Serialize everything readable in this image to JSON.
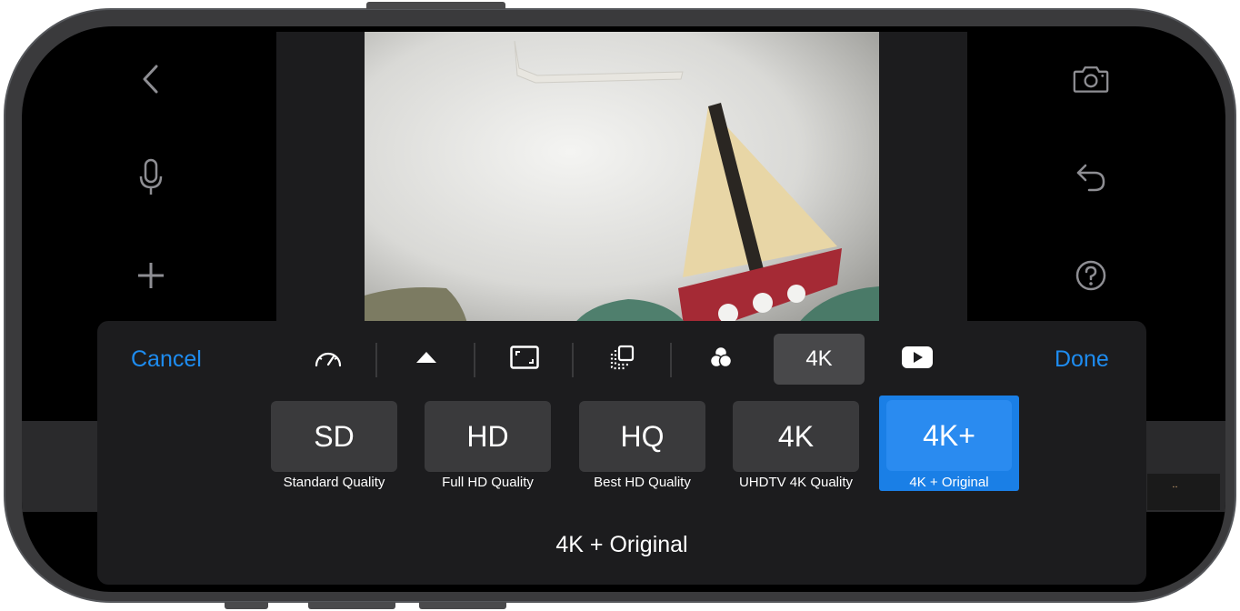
{
  "toolbar": {
    "cancel_label": "Cancel",
    "done_label": "Done",
    "tabs": [
      {
        "icon": "speedometer-icon"
      },
      {
        "icon": "triangle-up-icon"
      },
      {
        "icon": "aspect-ratio-icon"
      },
      {
        "icon": "frames-icon"
      },
      {
        "icon": "color-filter-icon"
      },
      {
        "label": "4K",
        "selected": true
      },
      {
        "icon": "youtube-play-icon"
      }
    ]
  },
  "side_icons": {
    "left": [
      "back-chevron-icon",
      "microphone-icon",
      "add-icon"
    ],
    "right": [
      "camera-icon",
      "undo-icon",
      "help-icon"
    ]
  },
  "quality": {
    "options": [
      {
        "code": "SD",
        "label": "Standard Quality"
      },
      {
        "code": "HD",
        "label": "Full HD Quality"
      },
      {
        "code": "HQ",
        "label": "Best HD Quality"
      },
      {
        "code": "4K",
        "label": "UHDTV 4K Quality"
      },
      {
        "code": "4K+",
        "label": "4K + Original",
        "selected": true
      }
    ],
    "current": "4K + Original"
  },
  "colors": {
    "accent": "#1e8cf0",
    "selected_card": "#1a7fe6",
    "panel": "#1c1c1e"
  }
}
